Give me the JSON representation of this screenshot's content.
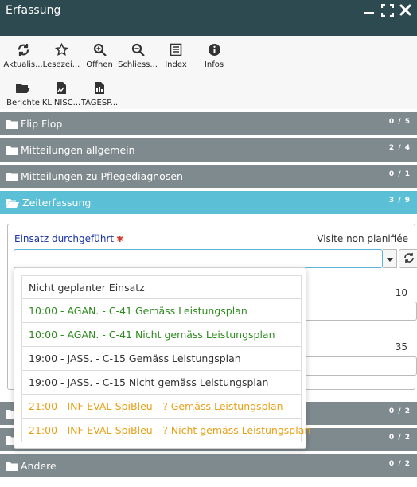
{
  "window": {
    "title": "Erfassung",
    "controls": [
      "minimize-icon",
      "maximize-icon",
      "close-icon"
    ]
  },
  "toolbar": {
    "row1": [
      {
        "label": "Aktualis...",
        "icon": "refresh-icon"
      },
      {
        "label": "Lesezei...",
        "icon": "star-icon"
      },
      {
        "label": "Öffnen",
        "icon": "zoom-in-icon"
      },
      {
        "label": "Schliess...",
        "icon": "zoom-out-icon"
      },
      {
        "label": "Index",
        "icon": "list-icon"
      },
      {
        "label": "Infos",
        "icon": "info-icon"
      }
    ],
    "row2": [
      {
        "label": "Berichte",
        "icon": "folder-open-icon"
      },
      {
        "label": "KLINISC...",
        "icon": "file-chart-icon"
      },
      {
        "label": "TAGESP...",
        "icon": "file-chart-icon"
      }
    ]
  },
  "panels": [
    {
      "label": "Flip Flop",
      "count": "0 / 5"
    },
    {
      "label": "Mitteilungen allgemein",
      "count": "2 / 4"
    },
    {
      "label": "Mitteilungen zu Pflegediagnosen",
      "count": "0 / 1"
    },
    {
      "label": "Zeiterfassung",
      "count": "3 / 9",
      "active": true
    }
  ],
  "zeiterfassung": {
    "field_label": "Einsatz durchgeführt",
    "field_right": "Visite non planifiée",
    "value1": "10",
    "value2": "35"
  },
  "dropdown": {
    "options": [
      {
        "text": "Nicht geplanter Einsatz",
        "color": "#333333"
      },
      {
        "text": "10:00 - AGAN. - C-41 Gemäss Leistungsplan",
        "color": "#2e8b1f"
      },
      {
        "text": "10:00 - AGAN. - C-41 Nicht gemäss Leistungsplan",
        "color": "#2e8b1f"
      },
      {
        "text": "19:00 - JASS. - C-15 Gemäss Leistungsplan",
        "color": "#333333"
      },
      {
        "text": "19:00 - JASS. - C-15 Nicht gemäss Leistungsplan",
        "color": "#333333"
      },
      {
        "text": "21:00 - INF-EVAL-SpiBleu - ? Gemäss Leistungsplan",
        "color": "#e8a016"
      },
      {
        "text": "21:00 - INF-EVAL-SpiBleu - ? Nicht gemäss Leistungsplan",
        "color": "#e8a016"
      }
    ]
  },
  "lower_panels": [
    {
      "label": "",
      "count": "0 / 2"
    },
    {
      "label": "",
      "count": "0 / 2"
    },
    {
      "label": "Andere",
      "count": "0 / 2"
    }
  ]
}
